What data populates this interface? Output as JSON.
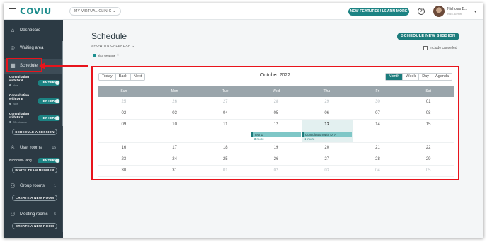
{
  "header": {
    "logo": "COVIU",
    "clinic_select": "MY VIRTUAL CLINIC ⌄",
    "new_features": "NEW FEATURES! LEARN MORE",
    "help": "?",
    "user_name": "Nicholas B...",
    "user_sub": "Nick Admin"
  },
  "sidebar": {
    "nav": {
      "dashboard": "Dashboard",
      "waiting_area": "Waiting area",
      "schedule": "Schedule",
      "user_rooms": "User rooms",
      "user_rooms_count": "15",
      "group_rooms": "Group rooms",
      "group_rooms_count": "1",
      "meeting_rooms": "Meeting rooms",
      "meeting_rooms_count": "5"
    },
    "rooms": [
      {
        "name": "Consultation with Dr A",
        "status": "Now",
        "enter": "ENTER"
      },
      {
        "name": "Consultation with Dr B",
        "status": "Now",
        "enter": "ENTER"
      },
      {
        "name": "Consultation with Dr C",
        "status": "22 minutes",
        "enter": "ENTER"
      }
    ],
    "schedule_session": "SCHEDULE A SESSION",
    "user_room_name": "Nicholas-Tang",
    "user_room_enter": "ENTER",
    "invite_team": "INVITE TEAM MEMBER",
    "create_room_1": "CREATE A NEW ROOM",
    "create_room_2": "CREATE A NEW ROOM"
  },
  "main": {
    "title": "Schedule",
    "show_on_calendar": "SHOW ON CALENDAR ⌄",
    "tag": "Your sessions",
    "tag_close": "×",
    "schedule_new": "SCHEDULE NEW SESSION",
    "include_cancelled": "Include cancelled"
  },
  "calendar": {
    "nav_buttons": [
      "Today",
      "Back",
      "Next"
    ],
    "month_title": "October 2022",
    "view_buttons": [
      "Month",
      "Week",
      "Day",
      "Agenda"
    ],
    "active_view": "Month",
    "day_headers": [
      "Sun",
      "Mon",
      "Tue",
      "Wed",
      "Thu",
      "Fri",
      "Sat"
    ],
    "weeks": [
      [
        "25",
        "26",
        "27",
        "28",
        "29",
        "30",
        "01"
      ],
      [
        "02",
        "03",
        "04",
        "05",
        "06",
        "07",
        "08"
      ],
      [
        "09",
        "10",
        "11",
        "12",
        "13",
        "14",
        "15"
      ],
      [
        "16",
        "17",
        "18",
        "19",
        "20",
        "21",
        "22"
      ],
      [
        "23",
        "24",
        "25",
        "26",
        "27",
        "28",
        "29"
      ],
      [
        "30",
        "31",
        "01",
        "02",
        "03",
        "04",
        "05"
      ]
    ],
    "events": [
      {
        "label": "Test 1",
        "more": "+3 more"
      },
      {
        "label": "Consultation with Dr A",
        "more": "+2 more"
      }
    ]
  },
  "colors": {
    "accent": "#1c7c7c",
    "sidebar": "#2c3a44",
    "highlight": "#e8141c"
  },
  "icons": [
    "menu-icon",
    "help-icon",
    "avatar",
    "dashboard-icon",
    "waiting-area-icon",
    "calendar-icon",
    "user-icon",
    "group-icon",
    "meeting-icon"
  ]
}
